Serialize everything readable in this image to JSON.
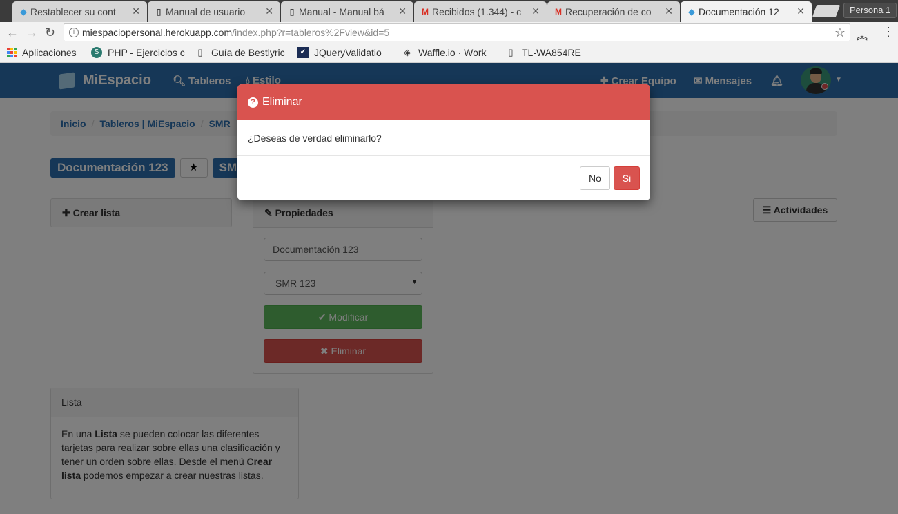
{
  "browser": {
    "tabs": [
      {
        "title": "Restablecer su cont",
        "icon": "cube-icon",
        "active": false
      },
      {
        "title": "Manual de usuario",
        "icon": "doc-icon",
        "active": false
      },
      {
        "title": "Manual - Manual bá",
        "icon": "doc-icon",
        "active": false
      },
      {
        "title": "Recibidos (1.344) - c",
        "icon": "gmail-icon",
        "active": false
      },
      {
        "title": "Recuperación de co",
        "icon": "gmail-icon",
        "active": false
      },
      {
        "title": "Documentación 12",
        "icon": "cube-icon",
        "active": true
      }
    ],
    "profile": "Persona 1",
    "url_host": "miespaciopersonal.herokuapp.com",
    "url_path": "/index.php?r=tableros%2Fview&id=5",
    "bookmarks": [
      {
        "label": "Aplicaciones",
        "icon": "apps-grid-icon"
      },
      {
        "label": "PHP - Ejercicios c",
        "icon": "php-icon"
      },
      {
        "label": "Guía de Bestlyric",
        "icon": "doc-icon"
      },
      {
        "label": "JQueryValidatio",
        "icon": "jquery-icon"
      },
      {
        "label": "Waffle.io · Work",
        "icon": "waffle-icon"
      },
      {
        "label": "TL-WA854RE",
        "icon": "doc-icon"
      }
    ]
  },
  "app": {
    "brand": "MiEspacio",
    "nav": {
      "tableros": "Tableros",
      "estilo": "Estilo",
      "crear_equipo": "Crear Equipo",
      "mensajes": "Mensajes"
    },
    "breadcrumb": [
      "Inicio",
      "Tableros | MiEspacio",
      "SMR"
    ],
    "board_title": "Documentación 123",
    "board_label2": "SM",
    "crear_lista": "Crear lista",
    "propiedades": {
      "header": "Propiedades",
      "name_value": "Documentación 123",
      "select_value": "SMR 123",
      "modificar": "Modificar",
      "eliminar": "Eliminar"
    },
    "actividades": "Actividades",
    "lista_panel": {
      "header": "Lista",
      "text_1": "En una ",
      "bold_1": "Lista",
      "text_2": " se pueden colocar las diferentes tarjetas para realizar sobre ellas una clasificación y tener un orden sobre ellas. Desde el menú ",
      "bold_2": "Crear lista",
      "text_3": " podemos empezar a crear nuestras listas."
    }
  },
  "modal": {
    "title": "Eliminar",
    "message": "¿Deseas de verdad eliminarlo?",
    "no": "No",
    "yes": "Si"
  },
  "colors": {
    "navbar": "#2c6fae",
    "danger": "#d9534f",
    "success": "#5cb85c"
  }
}
